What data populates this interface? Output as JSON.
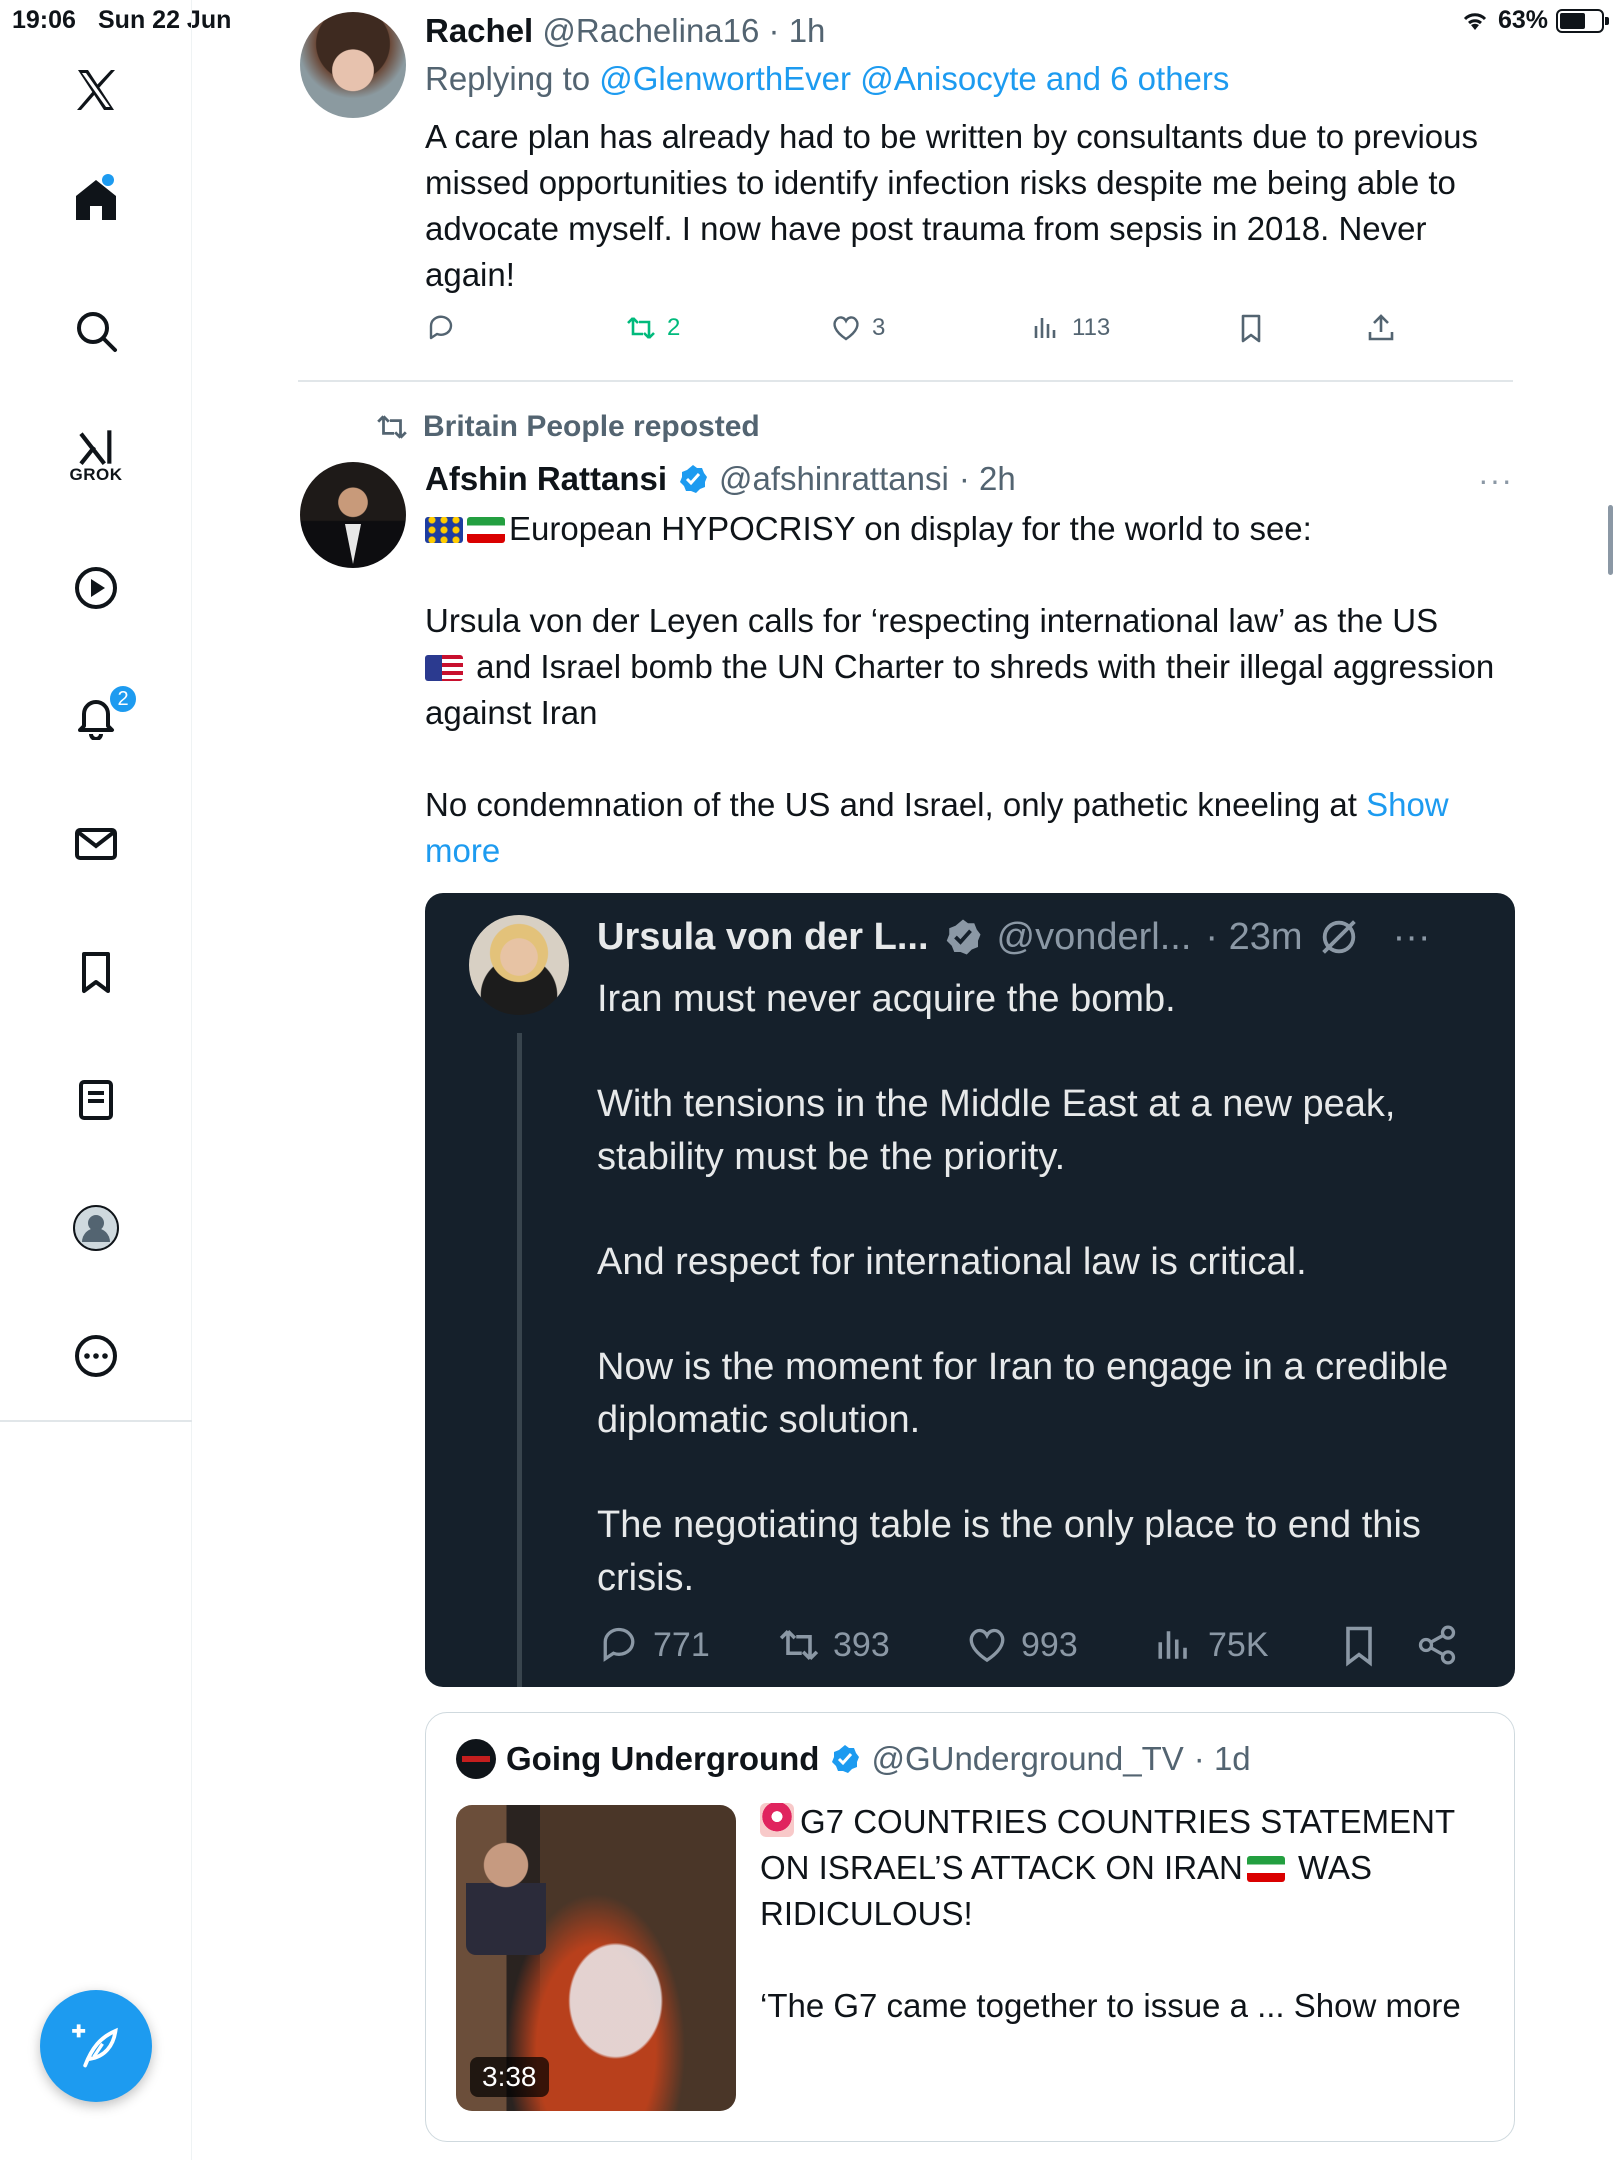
{
  "status_bar": {
    "time": "19:06",
    "date": "Sun 22 Jun",
    "battery": "63%",
    "battery_level": 0.63
  },
  "sidebar": {
    "grok_label": "GROK",
    "notifications_badge": "2"
  },
  "tweets": [
    {
      "name": "Rachel",
      "handle": "@Rachelina16",
      "time": "· 1h",
      "replying_prefix": "Replying to ",
      "replying_to": "@GlenworthEver @Anisocyte and 6 others",
      "text": "A care plan has already had to be written by consultants due to previous missed opportunities to identify infection risks despite me being able to advocate myself. I now have post trauma from sepsis in 2018. Never again!",
      "actions": {
        "reposts": "2",
        "likes": "3",
        "views": "113"
      }
    },
    {
      "repost_label": "Britain People reposted",
      "name": "Afshin Rattansi",
      "handle": "@afshinrattansi",
      "time": "· 2h",
      "more": "···",
      "text_p1": "European HYPOCRISY on display for the world to see:",
      "text_p2_a": "Ursula von der Leyen calls for ‘respecting international law’ as the US",
      "text_p2_b": "and Israel bomb the UN Charter to shreds with their illegal aggression against Iran",
      "text_p3": "No condemnation of the US and Israel, only pathetic kneeling at",
      "show_more": "Show more"
    }
  ],
  "embed": {
    "name": "Ursula von der L...",
    "handle": "@vonderl...",
    "time": "· 23m",
    "more": "···",
    "paragraphs": [
      "Iran must never acquire the bomb.",
      "With tensions in the Middle East at a new peak, stability must be the priority.",
      "And respect for international law is critical.",
      "Now is the moment for Iran to engage in a credible diplomatic solution.",
      "The negotiating table is the only place to end this crisis."
    ],
    "actions": {
      "replies": "771",
      "reposts": "393",
      "likes": "993",
      "views": "75K"
    }
  },
  "quote": {
    "name": "Going Underground",
    "handle": "@GUnderground_TV",
    "time": "· 1d",
    "headline": "G7 COUNTRIES COUNTRIES STATEMENT ON ISRAEL’S ATTACK ON IRAN",
    "headline_end": " WAS RIDICULOUS!",
    "snippet": "‘The G7 came together to issue a ... Show more",
    "duration": "3:38"
  },
  "colors": {
    "accent": "#1d9bf0",
    "repost_green": "#00ba7c",
    "muted": "#536471",
    "dark_bg": "#15202b"
  }
}
